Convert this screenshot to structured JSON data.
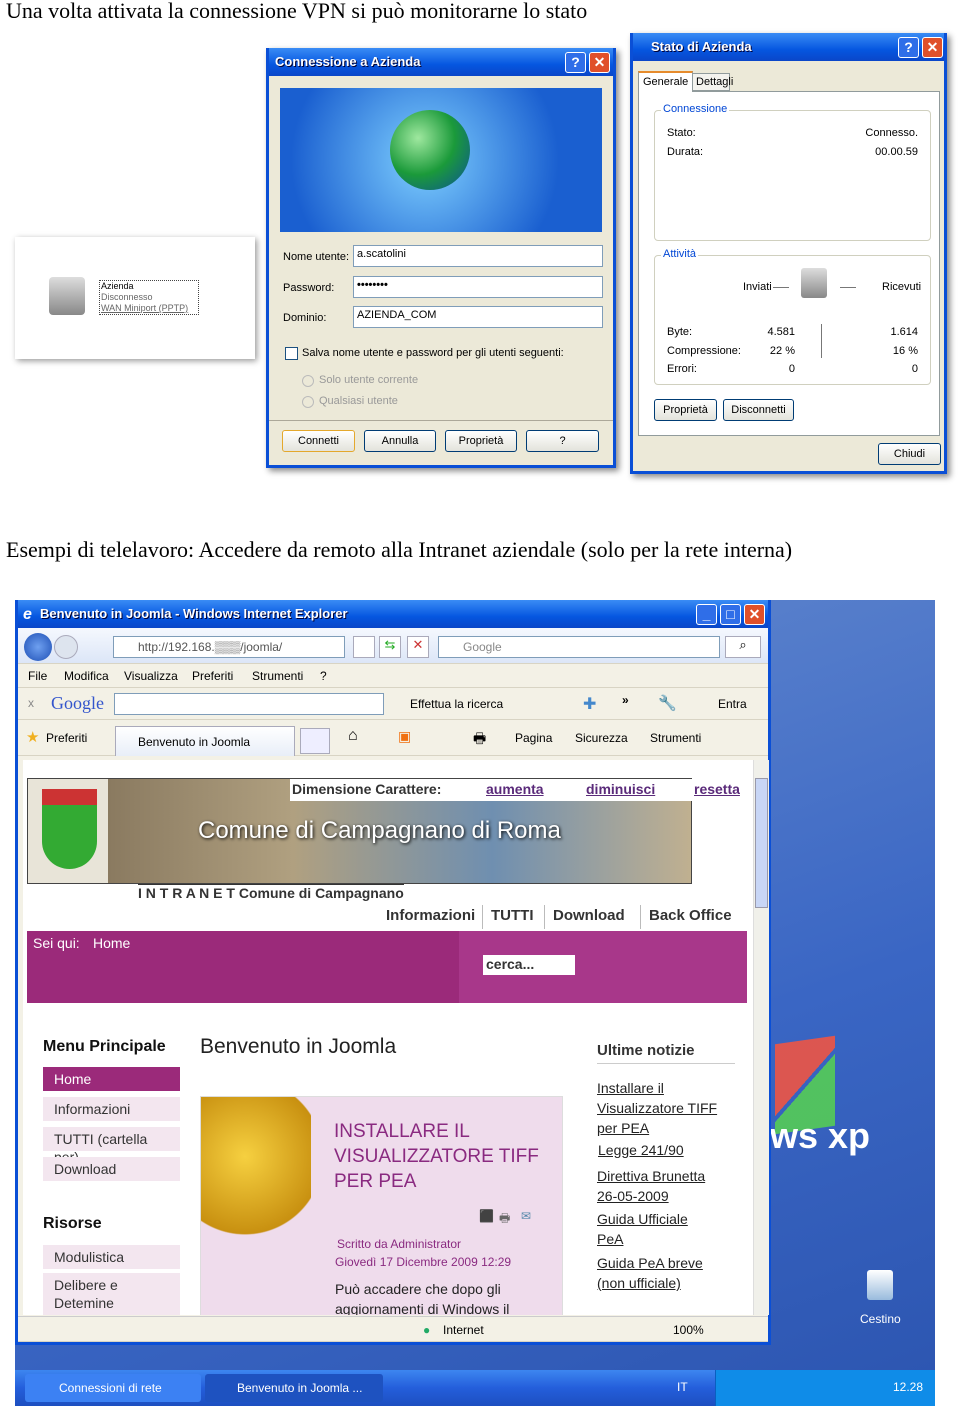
{
  "captions": {
    "top": "Una volta attivata la connessione VPN si può monitorarne lo stato",
    "middle": "Esempi di telelavoro: Accedere da remoto alla Intranet aziendale (solo per la rete interna)"
  },
  "connection_icon": {
    "name": "Azienda",
    "status": "Disconnesso",
    "device": "WAN Miniport (PPTP)"
  },
  "connect_dialog": {
    "title": "Connessione a Azienda",
    "username_label": "Nome utente:",
    "username": "a.scatolini",
    "password_label": "Password:",
    "password": "••••••••",
    "domain_label": "Dominio:",
    "domain": "AZIENDA_COM",
    "save_label": "Salva nome utente e password per gli utenti seguenti:",
    "radio_current": "Solo utente corrente",
    "radio_any": "Qualsiasi utente",
    "buttons": [
      "Connetti",
      "Annulla",
      "Proprietà",
      "?"
    ]
  },
  "status_dialog": {
    "title": "Stato di Azienda",
    "tabs": [
      "Generale",
      "Dettagli"
    ],
    "connection_group": "Connessione",
    "stato_label": "Stato:",
    "stato": "Connesso.",
    "durata_label": "Durata:",
    "durata": "00.00.59",
    "activity_group": "Attività",
    "sent_label": "Inviati",
    "received_label": "Ricevuti",
    "rows": [
      {
        "label": "Byte:",
        "sent": "4.581",
        "received": "1.614"
      },
      {
        "label": "Compressione:",
        "sent": "22 %",
        "received": "16 %"
      },
      {
        "label": "Errori:",
        "sent": "0",
        "received": "0"
      }
    ],
    "buttons": {
      "properties": "Proprietà",
      "disconnect": "Disconnetti",
      "close": "Chiudi"
    }
  },
  "browser": {
    "title": "Benvenuto in Joomla - Windows Internet Explorer",
    "url": "http://192.168.▒▒▒/joomla/",
    "search_placeholder": "Google",
    "menu": [
      "File",
      "Modifica",
      "Visualizza",
      "Preferiti",
      "Strumenti",
      "?"
    ],
    "google_toolbar": {
      "logo": "Google",
      "search_button": "Effettua la ricerca",
      "signin": "Entra"
    },
    "favorites": "Preferiti",
    "tab": "Benvenuto in Joomla",
    "command_bar": [
      "Pagina",
      "Sicurezza",
      "Strumenti"
    ],
    "status": {
      "zone": "Internet",
      "zoom": "100%"
    }
  },
  "site": {
    "font_size_label": "Dimensione Carattere:",
    "font_options": [
      "aumenta",
      "diminuisci",
      "resetta"
    ],
    "banner_text": "Comune di Campagnano di Roma",
    "intranet_title": "I N T R A N E T Comune di Campagnano",
    "nav": [
      "Informazioni",
      "TUTTI",
      "Download",
      "Back Office"
    ],
    "breadcrumb_label": "Sei qui:",
    "breadcrumb": "Home",
    "search": "cerca...",
    "main_menu_title": "Menu Principale",
    "main_menu": [
      "Home",
      "Informazioni",
      "TUTTI (cartella per)",
      "Download"
    ],
    "resources_title": "Risorse",
    "resources": [
      "Modulistica",
      "Delibere e Detemine"
    ],
    "page_title": "Benvenuto in Joomla",
    "article": {
      "title": "INSTALLARE IL VISUALIZZATORE TIFF PER PEA",
      "author": "Scritto da Administrator",
      "date": "Giovedì 17 Dicembre 2009 12:29",
      "text": "Può accadere che dopo gli aggiornamenti di Windows il"
    },
    "news_title": "Ultime notizie",
    "news": [
      "Installare il Visualizzatore TIFF per PEA",
      "Legge 241/90",
      "Direttiva Brunetta 26-05-2009",
      "Guida Ufficiale PeA",
      "Guida PeA breve (non ufficiale)"
    ]
  },
  "desktop": {
    "recycle_bin": "Cestino",
    "logo_text": "ws xp"
  },
  "taskbar": {
    "items": [
      "Connessioni di rete",
      "Benvenuto in Joomla ..."
    ],
    "language": "IT",
    "clock": "12.28"
  },
  "colors": {
    "xp_blue": "#0a4fd6",
    "site_purple": "#9b2a7a",
    "site_pink": "#f3e6ef"
  }
}
